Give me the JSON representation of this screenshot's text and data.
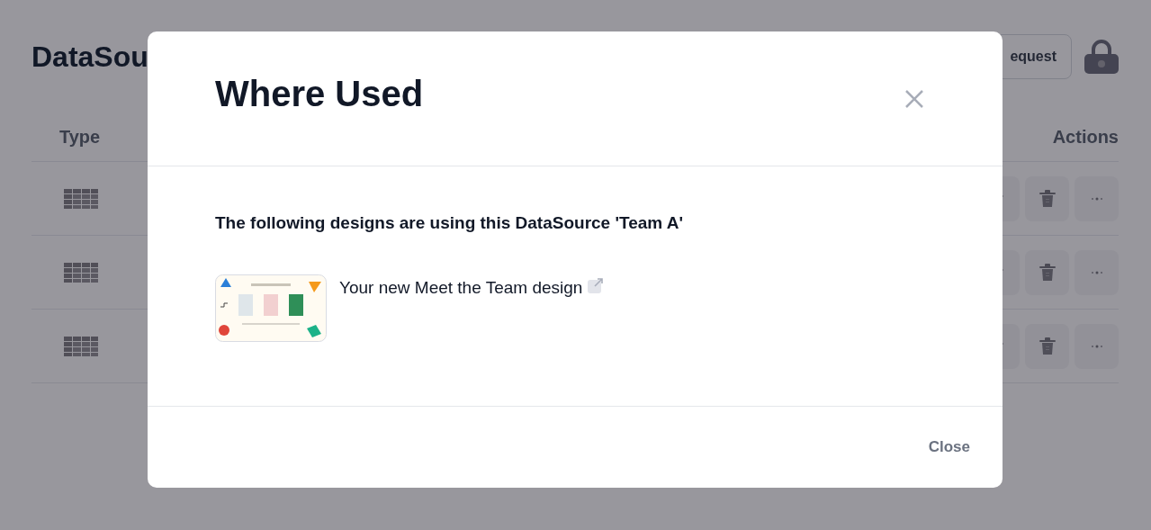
{
  "page": {
    "title": "DataSou",
    "request_button": "equest",
    "columns": [
      "Type",
      "Actions"
    ],
    "rows": [
      {
        "kind": "table"
      },
      {
        "kind": "table"
      },
      {
        "kind": "table"
      }
    ]
  },
  "modal": {
    "title": "Where Used",
    "message": "The following designs are using this DataSource 'Team A'",
    "designs": [
      {
        "kind": "picture",
        "name": "Your new Meet the Team design"
      }
    ],
    "close_button": "Close"
  }
}
